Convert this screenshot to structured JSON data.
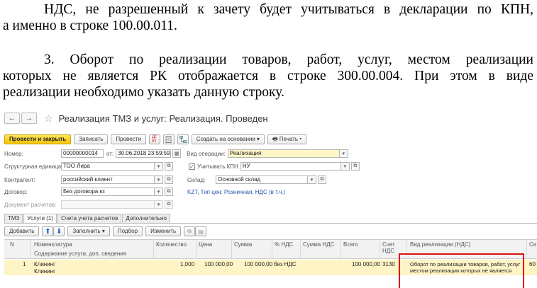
{
  "doc": {
    "p1_line1": "НДС, не разрешенный к зачету будет учитываться в декларации по КПН,",
    "p1_line2": "а именно в строке 100.00.011.",
    "p2_line1": "3. Оборот по реализации товаров, работ, услуг, местом реализации",
    "p2_line2": "которых не является РК отображается в строке 300.00.004. При этом в виде",
    "p2_line3": "реализации необходимо указать данную строку."
  },
  "window": {
    "back_icon": "arrow-left-icon",
    "forward_icon": "arrow-right-icon",
    "back_glyph": "←",
    "forward_glyph": "→",
    "star_glyph": "☆",
    "title": "Реализация ТМЗ и услуг: Реализация. Проведен"
  },
  "toolbar": {
    "post_close": "Провести и закрыть",
    "save": "Записать",
    "post": "Провести",
    "dtkt": "Дт\nКт",
    "create_based": "Создать на основании",
    "print": "Печать"
  },
  "form": {
    "number_label": "Номер:",
    "number_value": "00000000014",
    "from_label": "от:",
    "date_value": "30.06.2018 23:59:59",
    "op_type_label": "Вид операции:",
    "op_type_value": "Реализация",
    "struct_label": "Структурная единица:",
    "struct_value": "ТОО Лира",
    "kpn_label": "Учитывать КПН",
    "kpn_value": "НУ",
    "contractor_label": "Контрагент:",
    "contractor_value": "российский клиент",
    "warehouse_label": "Склад:",
    "warehouse_value": "Основной склад",
    "contract_label": "Договор:",
    "contract_value": "Без договора кз",
    "price_link": "KZT, Тип цен: Розничная, НДС (в т.ч.)",
    "settlement_label": "Документ расчетов:"
  },
  "tabs": [
    "ТМЗ",
    "Услуги (1)",
    "Счета учета расчетов",
    "Дополнительно"
  ],
  "table_toolbar": {
    "add": "Добавить",
    "fill": "Заполнить",
    "select": "Подбор",
    "change": "Изменить"
  },
  "table": {
    "headers": {
      "n": "N",
      "nomenclature": "Номенклатура",
      "content": "Содержание услуги, доп. сведения",
      "qty": "Количество",
      "price": "Цена",
      "sum": "Сумма",
      "vat_pct": "% НДС",
      "vat_sum": "Сумма НДС",
      "total": "Всего",
      "account": "Счет\nНДС",
      "sale_type": "Вид реализации (НДС)",
      "extra": "Се"
    },
    "rows": [
      {
        "n": "1",
        "nomenclature": "Клининг",
        "content": "Клининг",
        "qty": "1,000",
        "price": "100 000,00",
        "sum": "100 000,00",
        "vat_pct": "без НДС",
        "vat_sum": "",
        "total": "100 000,00",
        "account": "3130",
        "sale_type_l1": "Оборот по реализации товаров, работ, услуг",
        "sale_type_l2": "местом реализации которых не является",
        "extra": "60"
      }
    ]
  },
  "colors": {
    "primary_button": "#f5c400",
    "highlight_row": "#fff4c6",
    "red_box": "#e01010",
    "link": "#2255aa"
  }
}
